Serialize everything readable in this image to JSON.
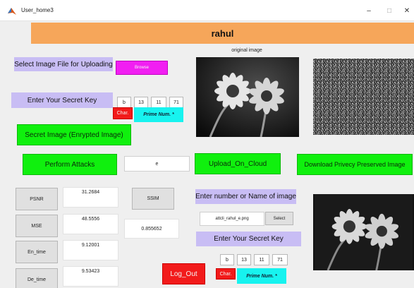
{
  "window": {
    "title": "User_home3",
    "min_glyph": "–",
    "max_glyph": "□",
    "close_glyph": "✕"
  },
  "header": {
    "user_name": "rahul"
  },
  "upload": {
    "label": "Select Image File for Uploading",
    "browse_label": "Browse"
  },
  "secret_key_top": {
    "label": "Enter Your Secret Key",
    "values": [
      "b",
      "13",
      "11",
      "71"
    ],
    "char_label": "Char.",
    "prime_label": "Prime Num. *"
  },
  "images": {
    "original_caption": "original image"
  },
  "buttons": {
    "secret_image": "Secret Image (Enrypted Image)",
    "perform_attacks": "Perform Attacks",
    "upload_on_cloud": "Upload_On_Cloud",
    "download_privacy": "Download Privecy Preserved Image",
    "logout": "Log_Out",
    "ssim": "SSIM",
    "select": "Select"
  },
  "attack_field": {
    "value": "e"
  },
  "metrics": {
    "psnr": {
      "label": "PSNR",
      "value": "31.2684"
    },
    "mse": {
      "label": "MSE",
      "value": "48.5556"
    },
    "en_time": {
      "label": "En_time",
      "value": "9.12001"
    },
    "de_time": {
      "label": "De_time",
      "value": "9.53423"
    },
    "ssim_value": "0.855652"
  },
  "image_select": {
    "label": "Enter number or Name of image",
    "file_value": "attcli_rahul_e.png"
  },
  "secret_key_bottom": {
    "label": "Enter Your Secret Key",
    "values": [
      "b",
      "13",
      "11",
      "71"
    ],
    "char_label": "Char.",
    "prime_label": "Prime Num. *"
  },
  "colors": {
    "header": "#f6a65a",
    "lavender": "#c8bdf4",
    "green": "#10f00e",
    "magenta": "#f11ff2",
    "red": "#f21b1b",
    "cyan": "#17f3ef"
  }
}
